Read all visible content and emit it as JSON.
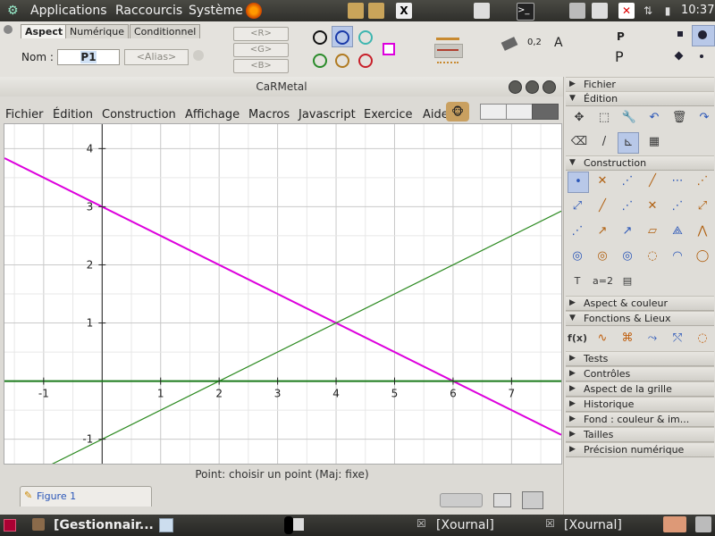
{
  "top_panel": {
    "menu": [
      "Applications",
      "Raccourcis",
      "Système"
    ],
    "clock": "10:37"
  },
  "aspect_bar": {
    "tabs": [
      "Aspect",
      "Numérique",
      "Conditionnel"
    ],
    "name_label": "Nom :",
    "name_value": "P1",
    "alias_placeholder": "<Alias>",
    "rgb": [
      "<R>",
      "<G>",
      "<B>"
    ],
    "style_label": "0,2",
    "point_big": "P",
    "point_small": "P"
  },
  "window": {
    "title": "CaRMetal",
    "menus": [
      "Fichier",
      "Édition",
      "Construction",
      "Affichage",
      "Macros",
      "Javascript",
      "Exercice",
      "Aide"
    ]
  },
  "status": {
    "message": "Point: choisir un point (Maj: fixe)",
    "figure_tab": "Figure 1"
  },
  "right_panel": {
    "sections": [
      {
        "label": "Fichier",
        "open": true
      },
      {
        "label": "Édition",
        "open": true
      },
      {
        "label": "Construction",
        "open": true
      },
      {
        "label": "Aspect & couleur",
        "open": false
      },
      {
        "label": "Fonctions & Lieux",
        "open": true
      },
      {
        "label": "Tests",
        "open": false
      },
      {
        "label": "Contrôles",
        "open": false
      },
      {
        "label": "Aspect de la grille",
        "open": false
      },
      {
        "label": "Historique",
        "open": false
      },
      {
        "label": "Fond : couleur & im...",
        "open": false
      },
      {
        "label": "Tailles",
        "open": false
      },
      {
        "label": "Précision numérique",
        "open": false
      }
    ],
    "fx_label": "f(x)",
    "text_tool": "T",
    "expr_tool": "a=2"
  },
  "taskbar": {
    "items": [
      "[Gestionnair...",
      "[Xournal]",
      "[Xournal]"
    ]
  },
  "chart_data": {
    "type": "line",
    "x_ticks": [
      "-1",
      "1",
      "2",
      "3",
      "4",
      "5",
      "6",
      "7"
    ],
    "y_ticks": [
      "-1",
      "1",
      "2",
      "3",
      "4"
    ],
    "xlim": [
      -1.67,
      7.85
    ],
    "ylim": [
      -1.42,
      4.42
    ],
    "grid": true,
    "series": [
      {
        "color": "#dd00dd",
        "points": [
          [
            -1.67,
            3.835
          ],
          [
            7.85,
            -0.925
          ]
        ]
      },
      {
        "color": "#2e8b22",
        "points": [
          [
            -1.67,
            -1.835
          ],
          [
            7.85,
            2.925
          ]
        ]
      },
      {
        "color": "#1a7a1a",
        "points": [
          [
            -1.67,
            0
          ],
          [
            7.85,
            0
          ]
        ]
      }
    ]
  }
}
